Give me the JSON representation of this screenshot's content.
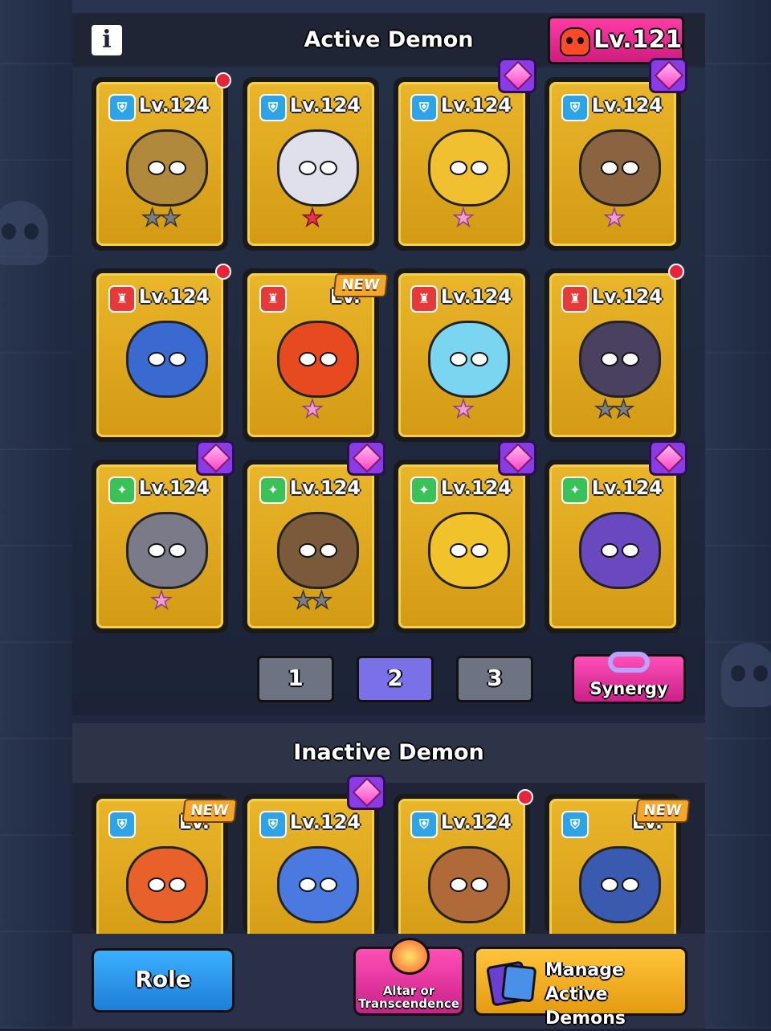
{
  "header": {
    "info_label": "i",
    "title": "Active Demon",
    "player_level": "Lv.121"
  },
  "active_demons": [
    {
      "level": "Lv.124",
      "role": "blue",
      "role_glyph": "⛨",
      "stars": "★★",
      "star_color": "grey",
      "badge": "dot",
      "art_color": "#b08a3a"
    },
    {
      "level": "Lv.124",
      "role": "blue",
      "role_glyph": "⛨",
      "stars": "★",
      "star_color": "red",
      "badge": "",
      "art_color": "#e0e0ec"
    },
    {
      "level": "Lv.124",
      "role": "blue",
      "role_glyph": "⛨",
      "stars": "★",
      "star_color": "pink",
      "badge": "gem",
      "art_color": "#f0c030"
    },
    {
      "level": "Lv.124",
      "role": "blue",
      "role_glyph": "⛨",
      "stars": "★",
      "star_color": "pink",
      "badge": "gem",
      "art_color": "#8a6440"
    },
    {
      "level": "Lv.124",
      "role": "red",
      "role_glyph": "♜",
      "stars": "",
      "star_color": "pink",
      "badge": "dot",
      "art_color": "#3a6ad0"
    },
    {
      "level": "Lv.",
      "role": "red",
      "role_glyph": "♜",
      "stars": "★",
      "star_color": "pink",
      "badge": "new",
      "art_color": "#e84a20"
    },
    {
      "level": "Lv.124",
      "role": "red",
      "role_glyph": "♜",
      "stars": "★",
      "star_color": "pink",
      "badge": "",
      "art_color": "#7ad6f0"
    },
    {
      "level": "Lv.124",
      "role": "red",
      "role_glyph": "♜",
      "stars": "★★",
      "star_color": "grey",
      "badge": "dot",
      "art_color": "#4a4060"
    },
    {
      "level": "Lv.124",
      "role": "green",
      "role_glyph": "✦",
      "stars": "★",
      "star_color": "pink",
      "badge": "gem",
      "art_color": "#7a7a88"
    },
    {
      "level": "Lv.124",
      "role": "green",
      "role_glyph": "✦",
      "stars": "★★",
      "star_color": "grey",
      "badge": "gem",
      "art_color": "#7a5a3a"
    },
    {
      "level": "Lv.124",
      "role": "green",
      "role_glyph": "✦",
      "stars": "",
      "star_color": "pink",
      "badge": "gem",
      "art_color": "#f2c22a"
    },
    {
      "level": "Lv.124",
      "role": "green",
      "role_glyph": "✦",
      "stars": "",
      "star_color": "pink",
      "badge": "gem",
      "art_color": "#6a48c0"
    }
  ],
  "pagination": {
    "pages": [
      "1",
      "2",
      "3"
    ],
    "current": "2"
  },
  "synergy_label": "Synergy",
  "inactive_title": "Inactive Demon",
  "inactive_demons": [
    {
      "level": "Lv.",
      "role": "blue",
      "role_glyph": "⛨",
      "badge": "new",
      "art_color": "#e8602a"
    },
    {
      "level": "Lv.124",
      "role": "blue",
      "role_glyph": "⛨",
      "badge": "gem",
      "art_color": "#4a7ae0"
    },
    {
      "level": "Lv.124",
      "role": "blue",
      "role_glyph": "⛨",
      "badge": "dot",
      "art_color": "#b06a3a"
    },
    {
      "level": "Lv.",
      "role": "blue",
      "role_glyph": "⛨",
      "badge": "new",
      "art_color": "#3a5ab0"
    }
  ],
  "new_label": "NEW",
  "bottom": {
    "role_label": "Role",
    "altar_label": "Altar or Transcendence",
    "manage_line1": "Manage",
    "manage_line2": "Active Demons"
  }
}
